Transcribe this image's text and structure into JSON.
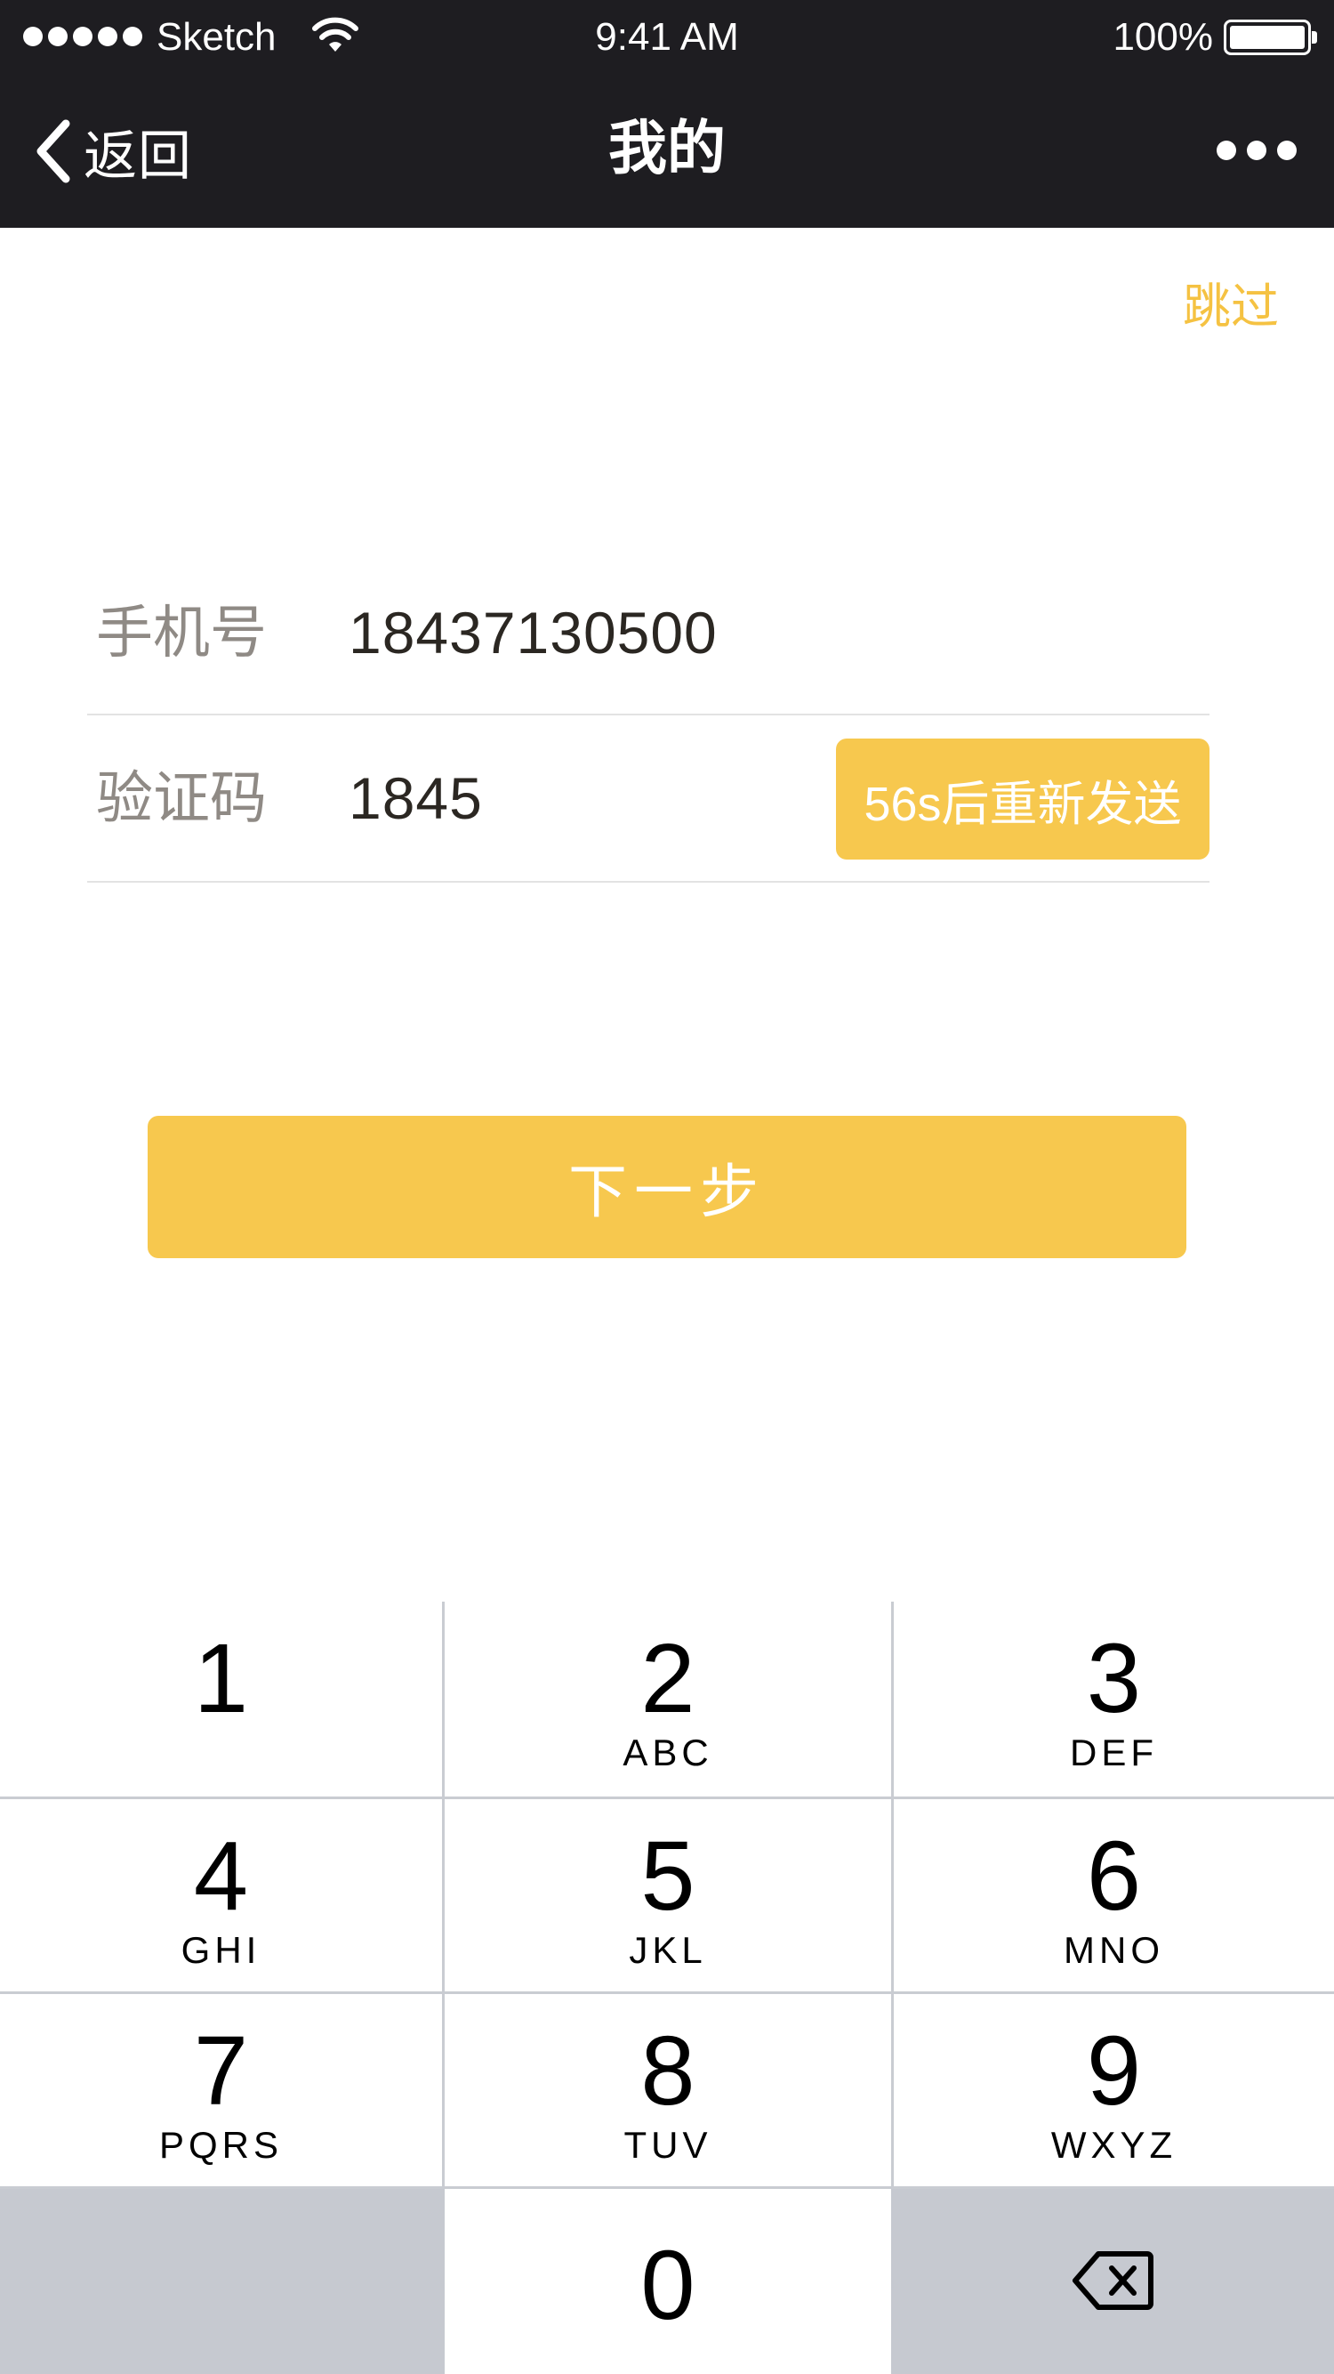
{
  "status_bar": {
    "carrier": "Sketch",
    "time": "9:41 AM",
    "battery_percent": "100%",
    "icons": [
      "signal-dots-icon",
      "wifi-icon",
      "battery-icon"
    ]
  },
  "nav": {
    "back_label": "返回",
    "title": "我的",
    "more_icon": "ellipsis-icon"
  },
  "skip_label": "跳过",
  "form": {
    "phone_label": "手机号",
    "phone_value": "18437130500",
    "code_label": "验证码",
    "code_value": "1845",
    "resend_label": "56s后重新发送"
  },
  "next_button_label": "下一步",
  "keypad": {
    "keys": [
      {
        "num": "1",
        "letters": ""
      },
      {
        "num": "2",
        "letters": "ABC"
      },
      {
        "num": "3",
        "letters": "DEF"
      },
      {
        "num": "4",
        "letters": "GHI"
      },
      {
        "num": "5",
        "letters": "JKL"
      },
      {
        "num": "6",
        "letters": "MNO"
      },
      {
        "num": "7",
        "letters": "PQRS"
      },
      {
        "num": "8",
        "letters": "TUV"
      },
      {
        "num": "9",
        "letters": "WXYZ"
      },
      {
        "num": "0",
        "letters": ""
      }
    ],
    "delete_icon": "backspace-icon"
  },
  "colors": {
    "accent": "#f7c84e",
    "skip_text": "#f5c242",
    "nav_bg": "#1e1d21",
    "keypad_gray": "#c6c9d0"
  }
}
